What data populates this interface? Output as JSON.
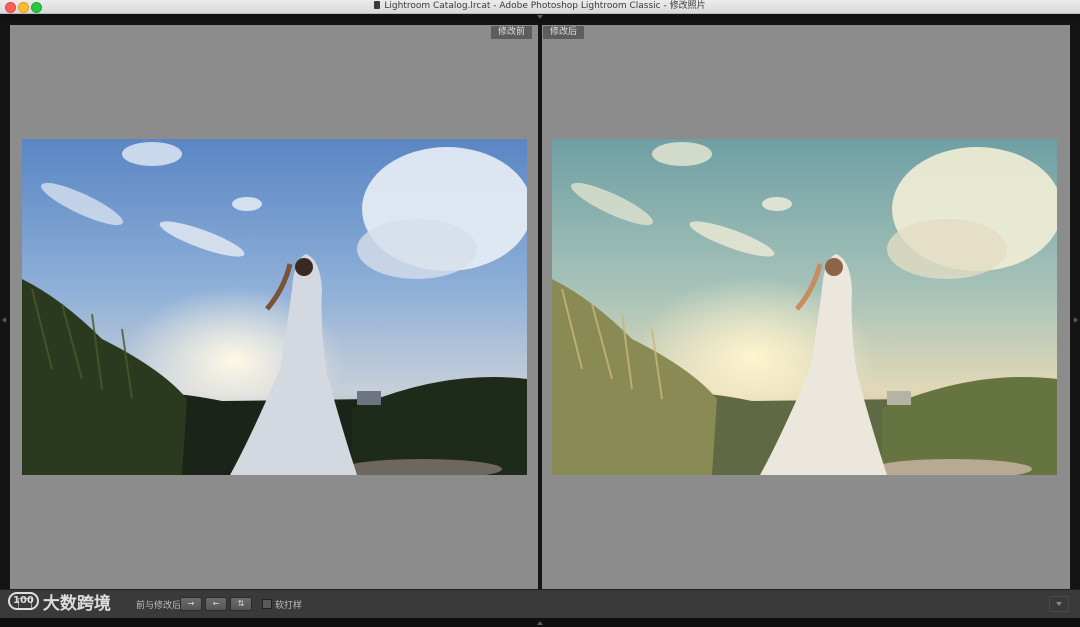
{
  "window": {
    "title": "Lightroom Catalog.lrcat - Adobe Photoshop Lightroom Classic - 修改照片",
    "icon": "document-icon"
  },
  "compare": {
    "before_label": "修改前",
    "after_label": "修改后"
  },
  "toolbar": {
    "label": "前与修改后:",
    "buttons": [
      {
        "icon": "copy-before-to-after-icon",
        "glyph": "→"
      },
      {
        "icon": "copy-after-to-before-icon",
        "glyph": "←"
      },
      {
        "icon": "swap-icon",
        "glyph": "⇅"
      }
    ],
    "softproof_label": "软打样",
    "softproof_checked": false
  },
  "watermark": {
    "badge": "100",
    "text": "大数跨境"
  },
  "colors": {
    "panel_bg": "#8c8c8c",
    "toolbar_bg": "#3a3a3a",
    "label_bg": "#5d5d5d"
  }
}
